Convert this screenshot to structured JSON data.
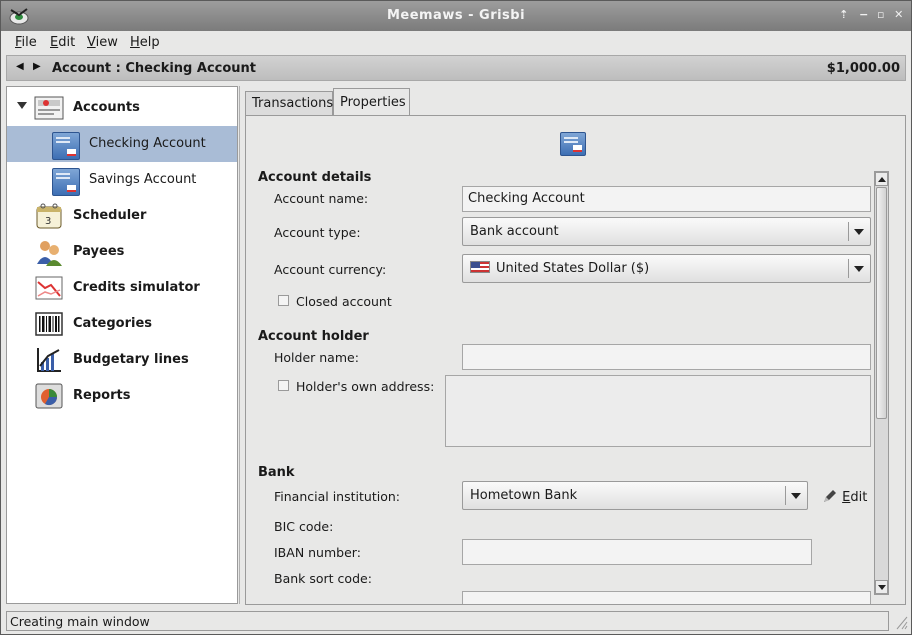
{
  "window": {
    "title": "Meemaws - Grisbi"
  },
  "menubar": {
    "items": [
      {
        "label": "File",
        "mnemonic": "F",
        "rest": "ile"
      },
      {
        "label": "Edit",
        "mnemonic": "E",
        "rest": "dit"
      },
      {
        "label": "View",
        "mnemonic": "V",
        "rest": "iew"
      },
      {
        "label": "Help",
        "mnemonic": "H",
        "rest": "elp"
      }
    ]
  },
  "header": {
    "title": "Account : Checking Account",
    "balance": "$1,000.00"
  },
  "sidebar": {
    "accounts_label": "Accounts",
    "accounts": [
      {
        "label": "Checking Account",
        "icon": "bank-card-icon"
      },
      {
        "label": "Savings Account",
        "icon": "bank-card-icon"
      }
    ],
    "items": [
      {
        "label": "Scheduler",
        "icon": "calendar-icon"
      },
      {
        "label": "Payees",
        "icon": "payees-icon"
      },
      {
        "label": "Credits simulator",
        "icon": "chart-icon"
      },
      {
        "label": "Categories",
        "icon": "barcode-icon"
      },
      {
        "label": "Budgetary lines",
        "icon": "budget-chart-icon"
      },
      {
        "label": "Reports",
        "icon": "pie-chart-icon"
      }
    ]
  },
  "tabs": [
    {
      "label": "Transactions"
    },
    {
      "label": "Properties"
    }
  ],
  "properties": {
    "account_details": {
      "title": "Account details",
      "name_label": "Account name:",
      "name_value": "Checking Account",
      "type_label": "Account type:",
      "type_value": "Bank account",
      "currency_label": "Account currency:",
      "currency_value": "United States Dollar ($)",
      "closed_label": "Closed account"
    },
    "account_holder": {
      "title": "Account holder",
      "holder_name_label": "Holder name:",
      "holder_name_value": "",
      "own_address_label": "Holder's own address:"
    },
    "bank": {
      "title": "Bank",
      "institution_label": "Financial institution:",
      "institution_value": "Hometown Bank",
      "edit_mnemonic": "E",
      "edit_rest": "dit",
      "bic_label": "BIC code:",
      "iban_label": "IBAN number:",
      "iban_value": "",
      "sort_code_label": "Bank sort code:"
    }
  },
  "statusbar": {
    "text": "Creating main window"
  }
}
